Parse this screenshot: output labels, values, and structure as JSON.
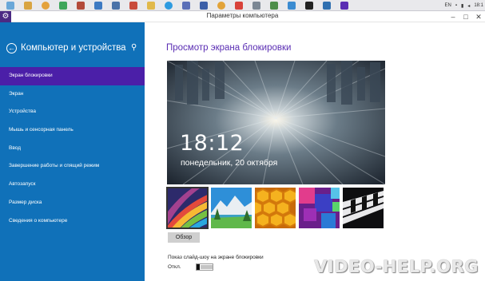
{
  "taskbar": {
    "icons": [
      "globe-icon",
      "browser-icon",
      "chrome-icon",
      "mail-icon",
      "app-icon",
      "shield-icon",
      "vk-icon",
      "media-icon",
      "folder-icon",
      "skype-icon",
      "photo-icon",
      "doc-icon",
      "search-icon",
      "yandex-icon",
      "gear-icon",
      "sign-icon",
      "ie-icon",
      "cmd-icon",
      "tv-icon",
      "settings-icon"
    ],
    "tray_lang": "EN",
    "tray_time": "18:1"
  },
  "window": {
    "title": "Параметры компьютера"
  },
  "sidebar": {
    "title": "Компьютер и устройства",
    "items": [
      {
        "label": "Экран блокировки",
        "active": true
      },
      {
        "label": "Экран"
      },
      {
        "label": "Устройства"
      },
      {
        "label": "Мышь и сенсорная панель"
      },
      {
        "label": "Ввод"
      },
      {
        "label": "Завершение работы и спящий режим"
      },
      {
        "label": "Автозапуск"
      },
      {
        "label": "Размер диска"
      },
      {
        "label": "Сведения о компьютере"
      }
    ]
  },
  "main": {
    "title": "Просмотр экрана блокировки",
    "preview": {
      "time": "18:12",
      "date": "понедельник, 20 октября"
    },
    "thumbnails": [
      "windows-stripes",
      "mountain-lake",
      "honeycomb",
      "purple-cubes",
      "piano-keys"
    ],
    "browse_label": "Обзор",
    "slideshow_label": "Показ слайд-шоу на экране блокировки",
    "slideshow_state": "Откл."
  },
  "watermark": "VIDEO-HELP.ORG",
  "colors": {
    "sidebar": "#1071b9",
    "active_item": "#4b1fa8",
    "title_accent": "#5a2db3"
  }
}
